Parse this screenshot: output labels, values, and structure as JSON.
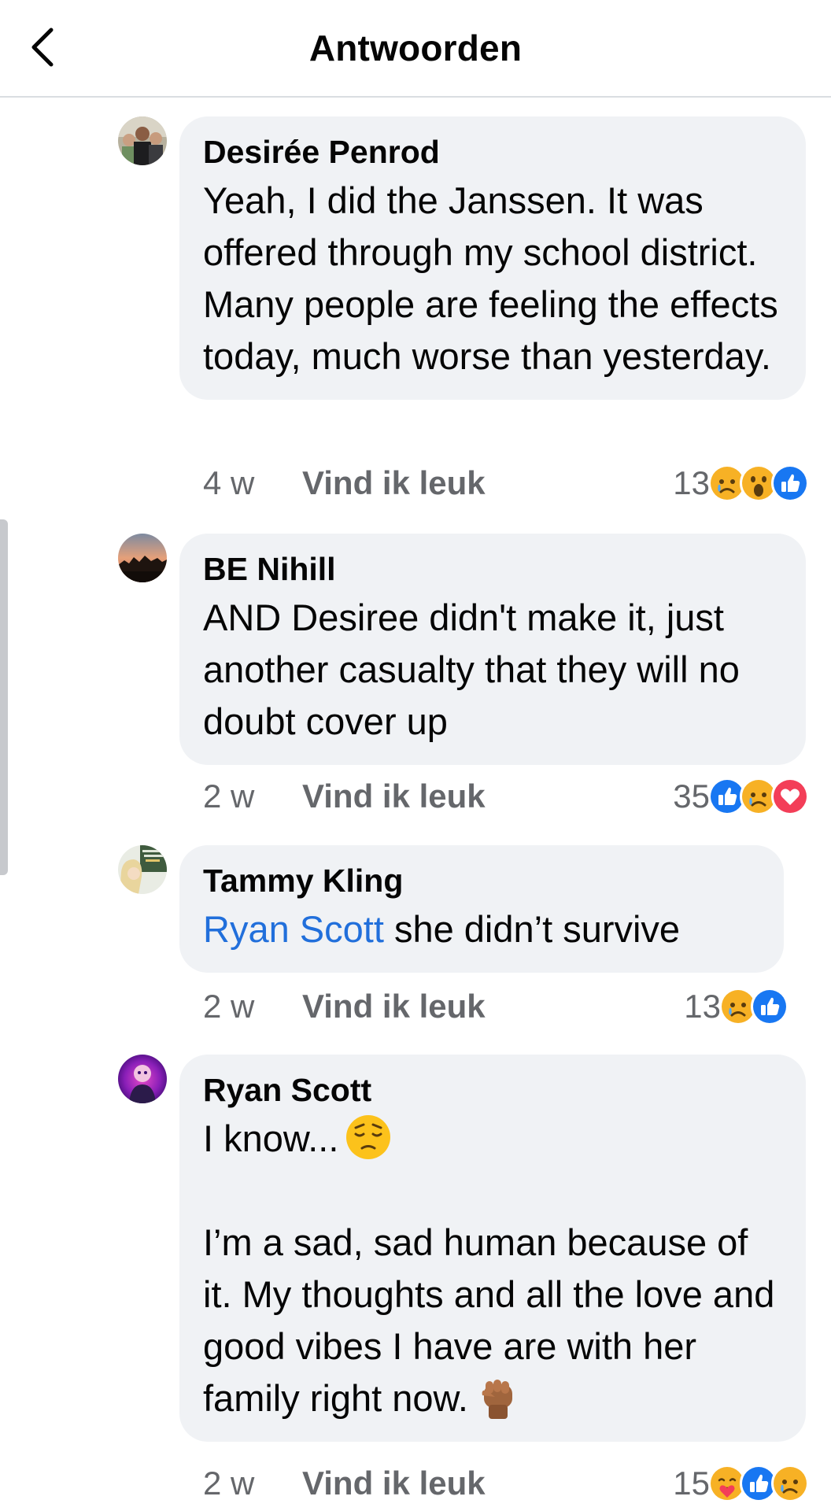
{
  "header": {
    "title": "Antwoorden",
    "back_icon": "chevron-left-icon"
  },
  "comments": [
    {
      "author": "Desirée Penrod",
      "text": "Yeah, I did the Janssen. It was offered through my school district. Many people are feeling the effects today, much worse than yesterday.",
      "time": "4 w",
      "like_label": "Vind ik leuk",
      "reaction_count": "13",
      "reactions": [
        "sad-reaction-icon",
        "wow-reaction-icon",
        "like-reaction-icon"
      ]
    },
    {
      "author": "BE Nihill",
      "text": "AND Desiree didn't make it, just another casualty that they will no doubt cover up",
      "time": "2 w",
      "like_label": "Vind ik leuk",
      "reaction_count": "35",
      "reactions": [
        "like-reaction-icon",
        "sad-reaction-icon",
        "love-reaction-icon"
      ]
    },
    {
      "author": "Tammy Kling",
      "mention": "Ryan Scott",
      "text": " she didn’t survive",
      "time": "2 w",
      "like_label": "Vind ik leuk",
      "reaction_count": "13",
      "reactions": [
        "sad-reaction-icon",
        "like-reaction-icon"
      ]
    },
    {
      "author": "Ryan Scott",
      "text_line1": "I know...",
      "text_para2": "I’m a sad, sad human because of it. My thoughts and all the love and good vibes I have are with her family right now.",
      "emoji1": "pensive-face-emoji",
      "emoji2": "raised-fist-emoji",
      "time": "2 w",
      "like_label": "Vind ik leuk",
      "reaction_count": "15",
      "reactions": [
        "care-reaction-icon",
        "like-reaction-icon",
        "sad-reaction-icon"
      ]
    }
  ],
  "colors": {
    "bubble": "#f0f2f5",
    "mention": "#216fdb",
    "meta_text": "#65676b",
    "like_blue": "#1877f2",
    "love_red": "#f33e58",
    "reaction_yellow": "#f7b125"
  }
}
